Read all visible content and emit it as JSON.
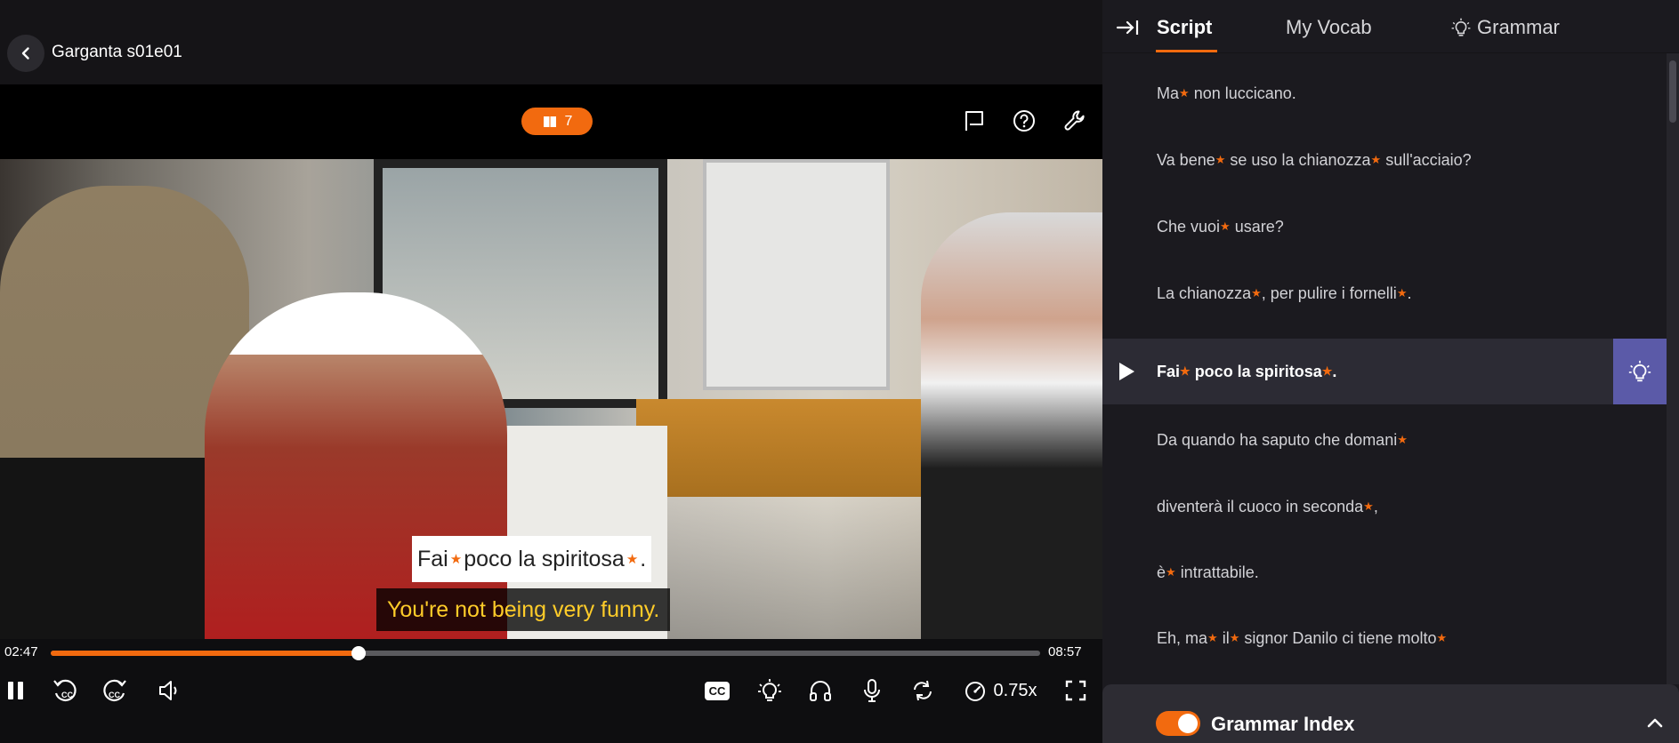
{
  "header": {
    "episode_title": "Garganta s01e01"
  },
  "toolbar": {
    "vocab_count": "7"
  },
  "subtitles": {
    "italian_parts": [
      "Fai",
      "poco la spiritosa",
      "."
    ],
    "english": "You're not being very funny."
  },
  "playback": {
    "current_time": "02:47",
    "total_time": "08:57",
    "progress_fraction": 0.311,
    "cc_label": "CC",
    "speed": "0.75x"
  },
  "tabs": {
    "script": "Script",
    "my_vocab": "My Vocab",
    "grammar": "Grammar"
  },
  "script_lines": [
    {
      "parts": [
        "Ma",
        "non luccicano."
      ],
      "stars": [
        0
      ]
    },
    {
      "parts": [
        "Va bene",
        "se uso la chianozza",
        "sull'acciaio?"
      ],
      "stars": [
        0,
        1
      ]
    },
    {
      "parts": [
        "Che vuoi",
        "usare?"
      ],
      "stars": [
        0
      ]
    },
    {
      "parts": [
        "La chianozza",
        ", per pulire i fornelli",
        "."
      ],
      "stars": [
        0,
        1
      ]
    },
    {
      "parts": [
        "Fai",
        "poco la spiritosa",
        "."
      ],
      "stars": [
        0,
        1
      ],
      "active": true
    },
    {
      "parts": [
        "Da quando ha saputo che domani"
      ],
      "stars": [
        0
      ]
    },
    {
      "parts": [
        "diventerà il cuoco in seconda",
        ","
      ],
      "stars": [
        0
      ]
    },
    {
      "parts": [
        "è",
        "intrattabile."
      ],
      "stars": [
        0
      ]
    },
    {
      "parts": [
        "Eh, ma",
        "il",
        "signor Danilo ci tiene molto"
      ],
      "stars": [
        0,
        1,
        2
      ]
    }
  ],
  "grammar_index": {
    "label": "Grammar Index",
    "enabled": true
  },
  "colors": {
    "accent": "#f26a0f",
    "active_line_bg": "#2c2b34",
    "hint_button": "#5b5aa8",
    "subtitle_en": "#ffcc29"
  },
  "icons": {
    "back": "chevron-left-icon",
    "vocab": "book-icon",
    "flag": "flag-icon",
    "help": "question-circle-icon",
    "settings": "wrench-icon",
    "play_pause": "pause-icon",
    "rewind": "rewind-cc-icon",
    "forward": "forward-cc-icon",
    "volume": "volume-icon",
    "hint": "lightbulb-icon",
    "audio": "headphones-icon",
    "mic": "microphone-icon",
    "loop": "repeat-icon",
    "speed": "speedometer-icon",
    "fullscreen": "fullscreen-icon",
    "collapse": "collapse-panel-icon",
    "line_play": "play-icon",
    "grammar_chevron": "chevron-up-icon"
  }
}
